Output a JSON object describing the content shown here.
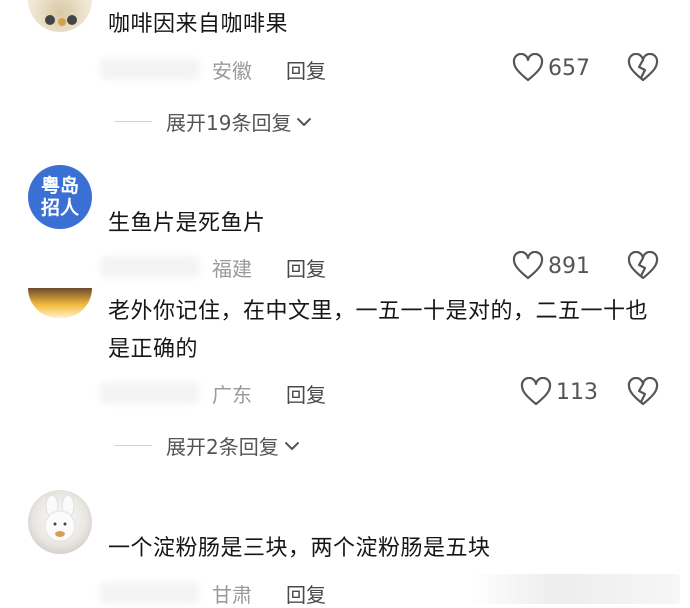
{
  "comments": [
    {
      "text": "咖啡因来自咖啡果",
      "location": "安徽",
      "reply_label": "回复",
      "likes": "657",
      "expand_label": "展开19条回复"
    },
    {
      "avatar_text": "粤岛招人",
      "text": "生鱼片是死鱼片",
      "location": "福建",
      "reply_label": "回复",
      "likes": "891"
    },
    {
      "text": "老外你记住，在中文里，一五一十是对的，二五一十也是正确的",
      "location": "广东",
      "reply_label": "回复",
      "likes": "113",
      "expand_label": "展开2条回复"
    },
    {
      "text": "一个淀粉肠是三块，两个淀粉肠是五块",
      "location": "甘肃",
      "reply_label": "回复"
    }
  ],
  "colors": {
    "avatar_blue": "#3a6fd3",
    "text": "#161616",
    "muted": "#9a9a9a"
  },
  "icons": [
    "heart-icon",
    "broken-heart-icon",
    "chevron-down-icon"
  ]
}
